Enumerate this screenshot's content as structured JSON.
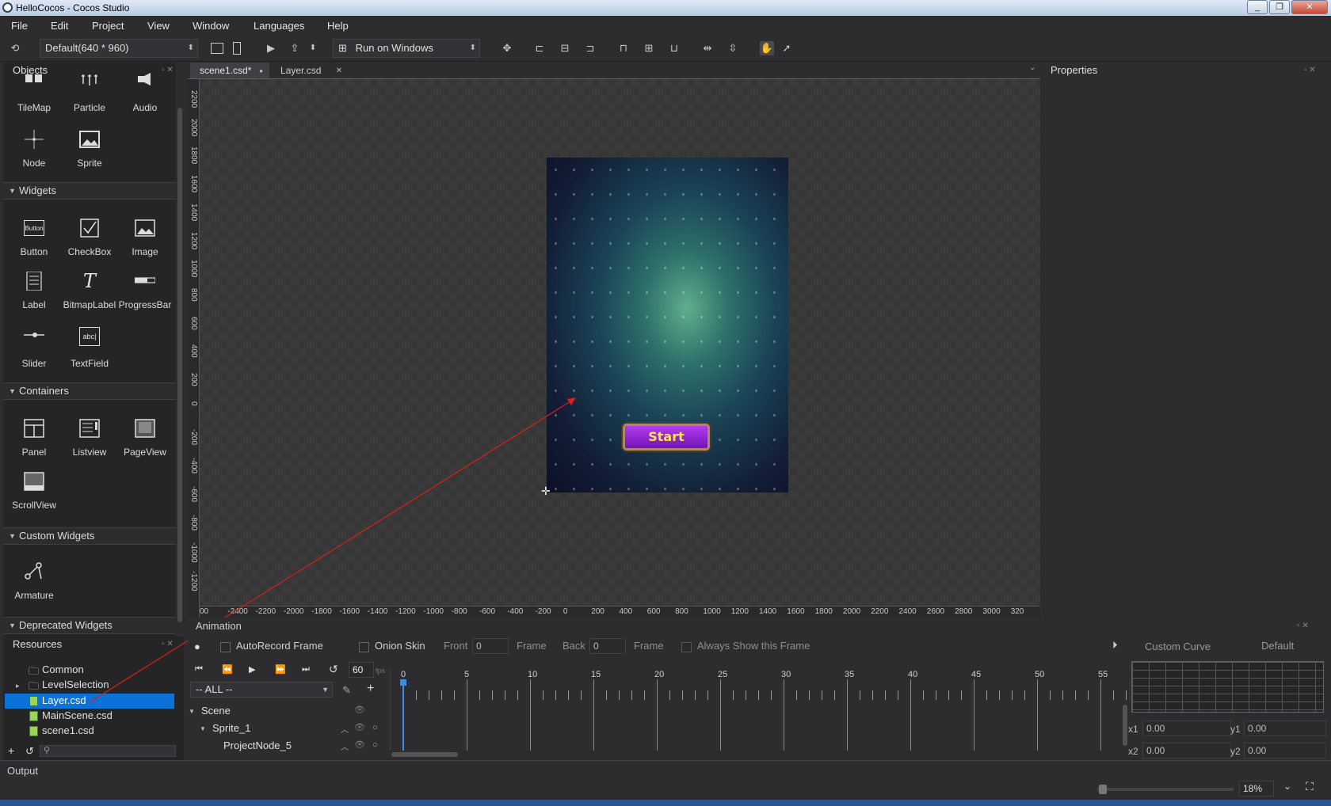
{
  "window": {
    "title": "HelloCocos - Cocos Studio"
  },
  "window_controls": {
    "minimize": "_",
    "restore": "❐",
    "close": "✕"
  },
  "menu": [
    "File",
    "Edit",
    "Project",
    "View",
    "Window",
    "Languages",
    "Help"
  ],
  "toolbar": {
    "resolution": "Default(640 * 960)",
    "run_target": "Run on Windows"
  },
  "objects_panel": {
    "title": "Objects",
    "top_items": [
      {
        "label": "TileMap",
        "icon": "tilemap-icon"
      },
      {
        "label": "Particle",
        "icon": "particle-icon"
      },
      {
        "label": "Audio",
        "icon": "audio-icon"
      },
      {
        "label": "Node",
        "icon": "node-icon"
      },
      {
        "label": "Sprite",
        "icon": "sprite-icon"
      }
    ],
    "sections": {
      "widgets": "Widgets",
      "containers": "Containers",
      "custom_widgets": "Custom Widgets",
      "deprecated_widgets": "Deprecated Widgets"
    },
    "widgets": [
      {
        "label": "Button",
        "icon": "button-widget-icon",
        "glyph": "Button"
      },
      {
        "label": "CheckBox",
        "icon": "checkbox-icon"
      },
      {
        "label": "Image",
        "icon": "image-icon"
      },
      {
        "label": "Label",
        "icon": "label-icon"
      },
      {
        "label": "BitmapLabel",
        "icon": "bitmaplabel-icon",
        "glyph": "T"
      },
      {
        "label": "ProgressBar",
        "icon": "progressbar-icon"
      },
      {
        "label": "Slider",
        "icon": "slider-icon"
      },
      {
        "label": "TextField",
        "icon": "textfield-icon",
        "glyph": "abc|"
      }
    ],
    "containers": [
      {
        "label": "Panel",
        "icon": "panel-icon"
      },
      {
        "label": "Listview",
        "icon": "listview-icon"
      },
      {
        "label": "PageView",
        "icon": "pageview-icon"
      },
      {
        "label": "ScrollView",
        "icon": "scrollview-icon"
      }
    ],
    "custom": [
      {
        "label": "Armature",
        "icon": "armature-icon"
      }
    ]
  },
  "resources": {
    "title": "Resources",
    "items": [
      {
        "label": "Common",
        "type": "folder",
        "expander": ""
      },
      {
        "label": "LevelSelection",
        "type": "folder",
        "expander": "▸"
      },
      {
        "label": "Layer.csd",
        "type": "csd",
        "selected": true,
        "expander": ""
      },
      {
        "label": "MainScene.csd",
        "type": "csd",
        "expander": ""
      },
      {
        "label": "scene1.csd",
        "type": "csd",
        "expander": ""
      }
    ],
    "add_glyph": "+",
    "refresh_glyph": "↺"
  },
  "editor": {
    "tabs": [
      {
        "label": "scene1.csd*",
        "active": true,
        "close": "●"
      },
      {
        "label": "Layer.csd",
        "active": false,
        "close": "✕"
      }
    ],
    "start_button": "Start",
    "vruler_labels": [
      "2200",
      "2000",
      "1800",
      "1600",
      "1400",
      "1200",
      "1000",
      "800",
      "600",
      "400",
      "200",
      "0",
      "-200",
      "-400",
      "-600",
      "-800",
      "-1000",
      "-1200"
    ],
    "hruler_labels": [
      "00",
      "-2400",
      "-2200",
      "-2000",
      "-1800",
      "-1600",
      "-1400",
      "-1200",
      "-1000",
      "-800",
      "-600",
      "-400",
      "-200",
      "0",
      "200",
      "400",
      "600",
      "800",
      "1000",
      "1200",
      "1400",
      "1600",
      "1800",
      "2000",
      "2200",
      "2400",
      "2600",
      "2800",
      "3000",
      "320"
    ]
  },
  "properties": {
    "title": "Properties"
  },
  "animation": {
    "title": "Animation",
    "autorecord": "AutoRecord Frame",
    "onion_skin": "Onion Skin",
    "front": "Front",
    "front_value": "0",
    "frame1": "Frame",
    "back": "Back",
    "back_value": "0",
    "frame2": "Frame",
    "always_show": "Always Show this Frame",
    "fps_value": "60",
    "fps_unit": "fps",
    "filter": "-- ALL --",
    "frame_labels": [
      "0",
      "5",
      "10",
      "15",
      "20",
      "25",
      "30",
      "35",
      "40",
      "45",
      "50",
      "55"
    ],
    "tree": [
      {
        "label": "Scene"
      },
      {
        "label": "Sprite_1"
      },
      {
        "label": "ProjectNode_5"
      }
    ],
    "curve": {
      "title": "Custom Curve",
      "preset": "Default",
      "x1_label": "x1",
      "x1": "0.00",
      "y1_label": "y1",
      "y1": "0.00",
      "x2_label": "x2",
      "x2": "0.00",
      "y2_label": "y2",
      "y2": "0.00"
    }
  },
  "output": {
    "title": "Output"
  },
  "status": {
    "zoom": "18%"
  }
}
